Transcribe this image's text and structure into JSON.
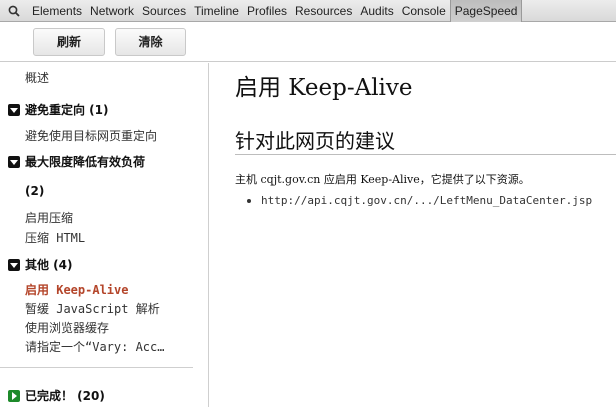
{
  "tabbar": {
    "tabs": [
      "Elements",
      "Network",
      "Sources",
      "Timeline",
      "Profiles",
      "Resources",
      "Audits",
      "Console",
      "PageSpeed"
    ],
    "active": "PageSpeed"
  },
  "toolbar": {
    "refresh_label": "刷新",
    "clear_label": "清除"
  },
  "sidebar": {
    "overview": "概述",
    "groups": {
      "redirects": {
        "label": "避免重定向 (1)",
        "items": [
          "避免使用目标网页重定向"
        ]
      },
      "payload": {
        "label": "最大限度降低有效负荷",
        "cont": "(2)",
        "items": [
          "启用压缩",
          "压缩 HTML"
        ]
      },
      "other": {
        "label": "其他 (4)",
        "items": [
          "启用 Keep-Alive",
          "暂缓 JavaScript 解析",
          "使用浏览器缓存",
          "请指定一个“Vary: Acc…"
        ]
      },
      "done": {
        "label": "已完成！ (20)"
      }
    }
  },
  "main": {
    "title": "启用 Keep-Alive",
    "section_title": "针对此网页的建议",
    "description": "主机 cqjt.gov.cn 应启用 Keep-Alive，它提供了以下资源。",
    "resources": [
      "http://api.cqjt.gov.cn/.../LeftMenu_DataCenter.jsp"
    ]
  }
}
